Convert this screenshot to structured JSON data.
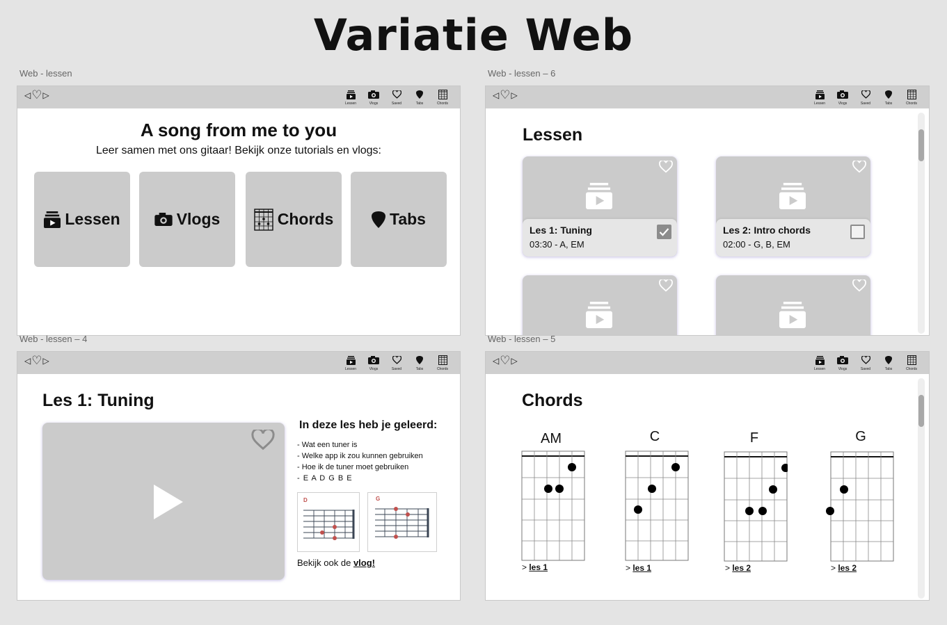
{
  "page": {
    "title": "Variatie Web"
  },
  "brand": {
    "left": "◁",
    "heart": "♡",
    "right": "▷"
  },
  "nav": [
    {
      "label": "Lessen",
      "icon": "lessons-icon"
    },
    {
      "label": "Vlogs",
      "icon": "camera-icon"
    },
    {
      "label": "Saved",
      "icon": "heart-icon"
    },
    {
      "label": "Tabs",
      "icon": "pick-icon"
    },
    {
      "label": "Chords",
      "icon": "chord-grid-icon"
    }
  ],
  "frames": {
    "home": {
      "label": "Web - lessen",
      "title": "A song from me to you",
      "subtitle": "Leer samen met ons gitaar! Bekijk onze tutorials en vlogs:",
      "tiles": [
        {
          "label": "Lessen",
          "icon": "lessons-icon"
        },
        {
          "label": "Vlogs",
          "icon": "camera-icon"
        },
        {
          "label": "Chords",
          "icon": "chord-grid-icon"
        },
        {
          "label": "Tabs",
          "icon": "pick-icon"
        }
      ]
    },
    "lessons": {
      "label": "Web - lessen – 6",
      "title": "Lessen",
      "cards": [
        {
          "name": "Les 1: Tuning",
          "meta": "03:30 - A, EM",
          "done": true
        },
        {
          "name": "Les 2: Intro chords",
          "meta": "02:00 - G, B, EM",
          "done": false
        },
        {
          "name": "",
          "meta": "",
          "done": false
        },
        {
          "name": "",
          "meta": "",
          "done": false
        }
      ]
    },
    "lesson_detail": {
      "label": "Web - lessen – 4",
      "title": "Les 1: Tuning",
      "learned_title": "In deze les heb je geleerd:",
      "learned": [
        "- Wat een tuner is",
        "- Welke app ik zou kunnen gebruiken",
        "- Hoe ik de tuner moet gebruiken",
        "- E A D G B E"
      ],
      "chord_images": [
        {
          "name": "D"
        },
        {
          "name": "G"
        }
      ],
      "see_also_text": "Bekijk ook de ",
      "see_also_link": "vlog!"
    },
    "chords": {
      "label": "Web - lessen – 5",
      "title": "Chords",
      "items": [
        {
          "name": "AM",
          "link_prefix": "> ",
          "link": "les 1"
        },
        {
          "name": "C",
          "link_prefix": "> ",
          "link": "les 1"
        },
        {
          "name": "F",
          "link_prefix": "> ",
          "link": "les 2"
        },
        {
          "name": "G",
          "link_prefix": "> ",
          "link": "les 2"
        }
      ]
    }
  },
  "colors": {
    "background": "#e4e4e4",
    "bar": "#cfcfcf",
    "tile": "#cbcbcb",
    "accent_shadow": "#5a46b4",
    "check": "#8c8c8c"
  }
}
